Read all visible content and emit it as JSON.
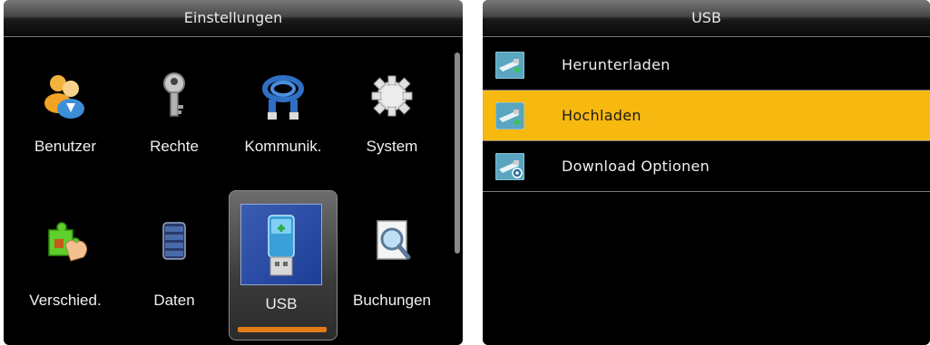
{
  "left": {
    "title": "Einstellungen",
    "items": [
      {
        "label": "Benutzer",
        "icon": "users-icon"
      },
      {
        "label": "Rechte",
        "icon": "key-icon"
      },
      {
        "label": "Kommunik.",
        "icon": "network-cable-icon"
      },
      {
        "label": "System",
        "icon": "gear-icon"
      },
      {
        "label": "Verschied.",
        "icon": "puzzle-hand-icon"
      },
      {
        "label": "Daten",
        "icon": "database-icon"
      },
      {
        "label": "USB",
        "icon": "usb-stick-icon",
        "selected": true
      },
      {
        "label": "Buchungen",
        "icon": "magnifier-document-icon"
      }
    ],
    "accent": "#e17b17"
  },
  "right": {
    "title": "USB",
    "items": [
      {
        "label": "Herunterladen",
        "icon": "usb-download-icon"
      },
      {
        "label": "Hochladen",
        "icon": "usb-upload-icon",
        "selected": true
      },
      {
        "label": "Download Optionen",
        "icon": "usb-settings-icon"
      }
    ],
    "highlight": "#f7b80f"
  }
}
